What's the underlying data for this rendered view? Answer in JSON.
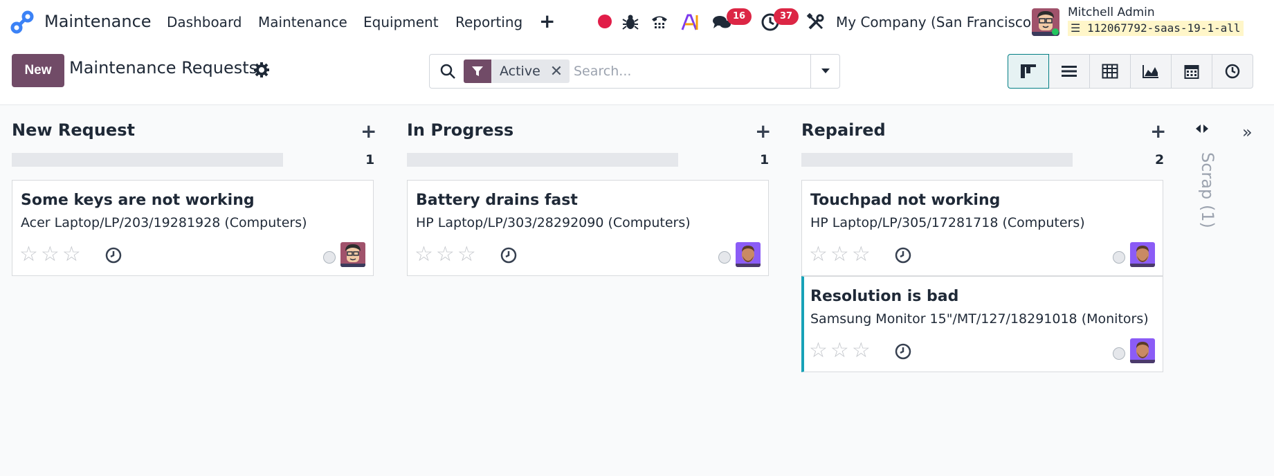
{
  "app": {
    "name": "Maintenance"
  },
  "menu": [
    "Dashboard",
    "Maintenance",
    "Equipment",
    "Reporting"
  ],
  "badges": {
    "messages": "16",
    "activities": "37"
  },
  "company": "My Company (San Francisco)",
  "user": {
    "name": "Mitchell Admin",
    "database": "112067792-saas-19-1-all"
  },
  "control": {
    "new_label": "New",
    "title": "Maintenance Requests",
    "facet": "Active",
    "search_placeholder": "Search..."
  },
  "views": [
    "kanban-icon",
    "list-icon",
    "pivot-icon",
    "graph-icon",
    "calendar-icon",
    "activity-icon"
  ],
  "columns": [
    {
      "title": "New Request",
      "count": "1",
      "cards": [
        {
          "title": "Some keys are not working",
          "subtitle": "Acer Laptop/LP/203/19281928 (Computers)",
          "avatar": "mitchell-avatar"
        }
      ]
    },
    {
      "title": "In Progress",
      "count": "1",
      "cards": [
        {
          "title": "Battery drains fast",
          "subtitle": "HP Laptop/LP/303/28292090 (Computers)",
          "avatar": "technician-avatar"
        }
      ]
    },
    {
      "title": "Repaired",
      "count": "2",
      "cards": [
        {
          "title": "Touchpad not working",
          "subtitle": "HP Laptop/LP/305/17281718 (Computers)",
          "avatar": "technician-avatar"
        },
        {
          "title": "Resolution is bad",
          "subtitle": "Samsung Monitor 15\"/MT/127/18291018 (Monitors)",
          "avatar": "technician-avatar"
        }
      ]
    }
  ],
  "folded_column": "Scrap (1)",
  "colors": {
    "brand": "#714b67",
    "accent": "#017e84",
    "badge": "#dc2645",
    "stripe": "#17a2b8"
  }
}
